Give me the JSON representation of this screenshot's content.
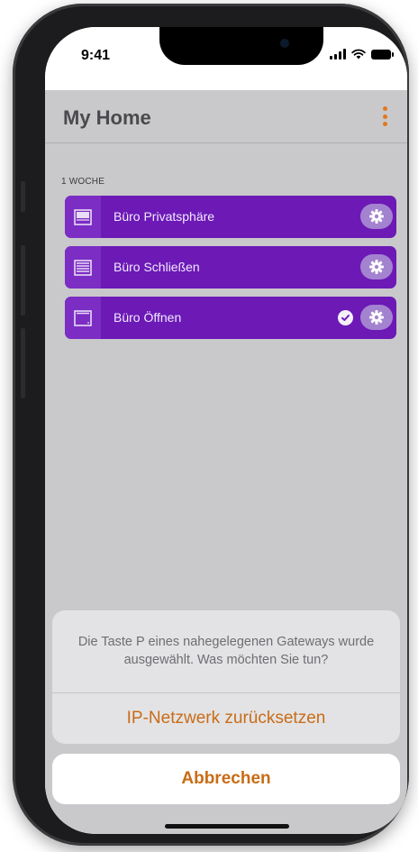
{
  "status_bar": {
    "time": "9:41"
  },
  "header": {
    "title": "My Home",
    "menu_icon": "kebab-menu-icon"
  },
  "section": {
    "label": "1 WOCHE"
  },
  "rows": [
    {
      "label": "Büro Privatsphäre",
      "icon": "blind-partial-icon",
      "checked": false
    },
    {
      "label": "Büro Schließen",
      "icon": "blind-closed-icon",
      "checked": false
    },
    {
      "label": "Büro Öffnen",
      "icon": "blind-open-icon",
      "checked": true
    }
  ],
  "action_sheet": {
    "message": "Die Taste P eines nahegelegenen Gateways wurde ausgewählt. Was möchten Sie tun?",
    "action_label": "IP-Netzwerk zurücksetzen",
    "cancel_label": "Abbrechen"
  },
  "colors": {
    "row_background": "#6c19b6",
    "accent_orange": "#c96c16",
    "app_background": "#c9c9cb"
  }
}
